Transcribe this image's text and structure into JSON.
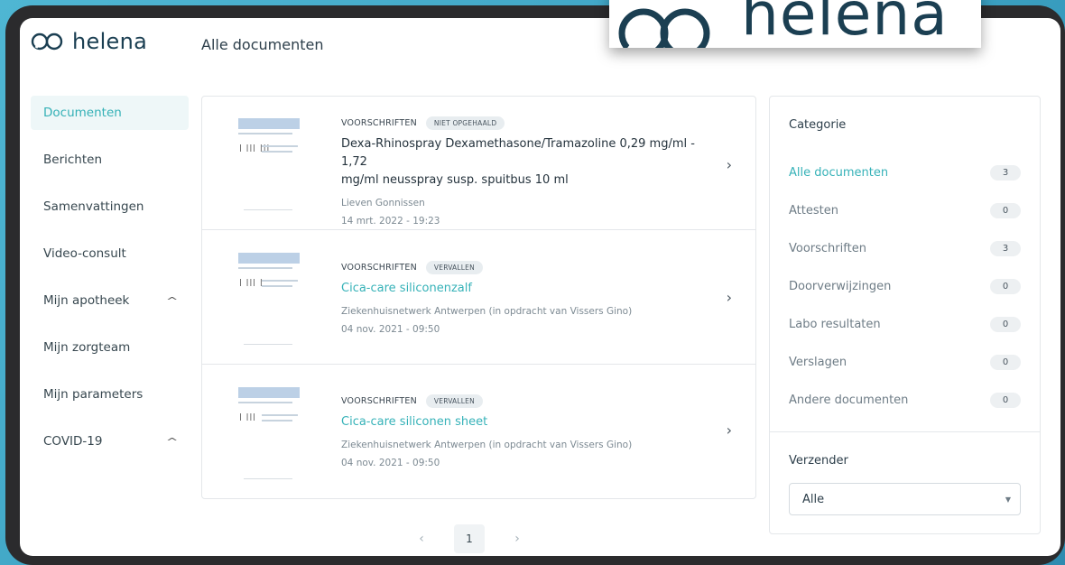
{
  "app": {
    "logo_text": "helena",
    "page_title": "Alle documenten"
  },
  "sidebar": {
    "items": [
      {
        "label": "Documenten",
        "active": true,
        "expand": false
      },
      {
        "label": "Berichten",
        "active": false,
        "expand": false
      },
      {
        "label": "Samenvattingen",
        "active": false,
        "expand": false
      },
      {
        "label": "Video-consult",
        "active": false,
        "expand": false
      },
      {
        "label": "Mijn apotheek",
        "active": false,
        "expand": true
      },
      {
        "label": "Mijn zorgteam",
        "active": false,
        "expand": false
      },
      {
        "label": "Mijn parameters",
        "active": false,
        "expand": false
      },
      {
        "label": "COVID-19",
        "active": false,
        "expand": true
      }
    ]
  },
  "documents": [
    {
      "category": "VOORSCHRIFTEN",
      "status": "NIET OPGEHAALD",
      "title_line1": "Dexa-Rhinospray Dexamethasone/Tramazoline 0,29 mg/ml - 1,72",
      "title_line2": "mg/ml neusspray susp. spuitbus 10 ml",
      "issuer": "Lieven Gonnissen",
      "date": "14 mrt. 2022 - 19:23"
    },
    {
      "category": "VOORSCHRIFTEN",
      "status": "VERVALLEN",
      "title_line1": "Cica-care siliconenzalf",
      "title_line2": "",
      "issuer": "Ziekenhuisnetwerk Antwerpen (in opdracht van Vissers Gino)",
      "date": "04 nov. 2021 - 09:50"
    },
    {
      "category": "VOORSCHRIFTEN",
      "status": "VERVALLEN",
      "title_line1": "Cica-care siliconen sheet",
      "title_line2": "",
      "issuer": "Ziekenhuisnetwerk Antwerpen (in opdracht van Vissers Gino)",
      "date": "04 nov. 2021 - 09:50"
    }
  ],
  "pagination": {
    "current_page": "1",
    "prev_icon": "chevron-left-icon",
    "next_icon": "chevron-right-icon"
  },
  "filter": {
    "category_heading": "Categorie",
    "categories": [
      {
        "label": "Alle documenten",
        "count": "3",
        "active": true
      },
      {
        "label": "Attesten",
        "count": "0",
        "active": false
      },
      {
        "label": "Voorschriften",
        "count": "3",
        "active": false
      },
      {
        "label": "Doorverwijzingen",
        "count": "0",
        "active": false
      },
      {
        "label": "Labo resultaten",
        "count": "0",
        "active": false
      },
      {
        "label": "Verslagen",
        "count": "0",
        "active": false
      },
      {
        "label": "Andere documenten",
        "count": "0",
        "active": false
      }
    ],
    "sender_heading": "Verzender",
    "sender_value": "Alle"
  },
  "watermark": {
    "text": "helena"
  },
  "colors": {
    "accent": "#36b2b8",
    "brand": "#1b3f52",
    "background": "#3a9fc0"
  },
  "icons": {
    "row_chevron": "chevron-right-icon",
    "expand": "chevron-up-icon",
    "select_caret": "caret-down-icon",
    "logo": "helena-logo-icon"
  }
}
